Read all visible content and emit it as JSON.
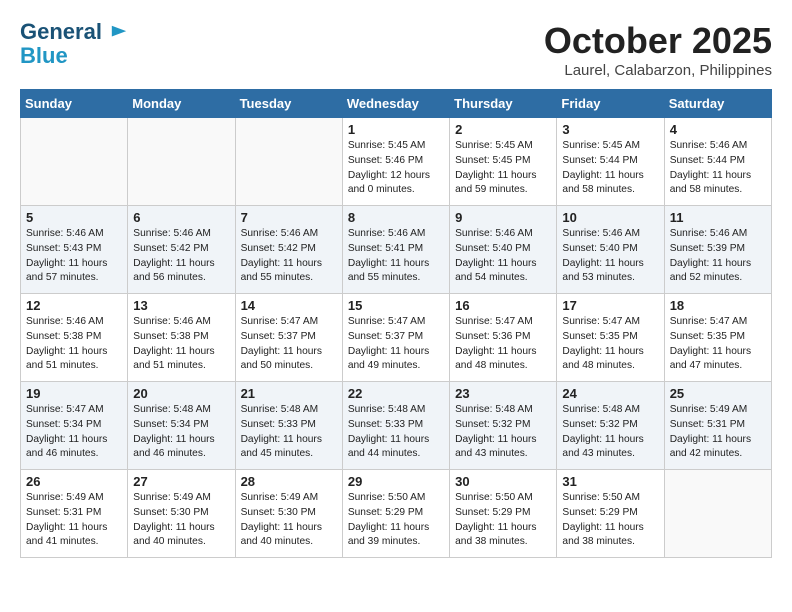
{
  "header": {
    "logo_line1": "General",
    "logo_line2": "Blue",
    "month": "October 2025",
    "location": "Laurel, Calabarzon, Philippines"
  },
  "days_of_week": [
    "Sunday",
    "Monday",
    "Tuesday",
    "Wednesday",
    "Thursday",
    "Friday",
    "Saturday"
  ],
  "weeks": [
    [
      {
        "day": "",
        "content": ""
      },
      {
        "day": "",
        "content": ""
      },
      {
        "day": "",
        "content": ""
      },
      {
        "day": "1",
        "content": "Sunrise: 5:45 AM\nSunset: 5:46 PM\nDaylight: 12 hours\nand 0 minutes."
      },
      {
        "day": "2",
        "content": "Sunrise: 5:45 AM\nSunset: 5:45 PM\nDaylight: 11 hours\nand 59 minutes."
      },
      {
        "day": "3",
        "content": "Sunrise: 5:45 AM\nSunset: 5:44 PM\nDaylight: 11 hours\nand 58 minutes."
      },
      {
        "day": "4",
        "content": "Sunrise: 5:46 AM\nSunset: 5:44 PM\nDaylight: 11 hours\nand 58 minutes."
      }
    ],
    [
      {
        "day": "5",
        "content": "Sunrise: 5:46 AM\nSunset: 5:43 PM\nDaylight: 11 hours\nand 57 minutes."
      },
      {
        "day": "6",
        "content": "Sunrise: 5:46 AM\nSunset: 5:42 PM\nDaylight: 11 hours\nand 56 minutes."
      },
      {
        "day": "7",
        "content": "Sunrise: 5:46 AM\nSunset: 5:42 PM\nDaylight: 11 hours\nand 55 minutes."
      },
      {
        "day": "8",
        "content": "Sunrise: 5:46 AM\nSunset: 5:41 PM\nDaylight: 11 hours\nand 55 minutes."
      },
      {
        "day": "9",
        "content": "Sunrise: 5:46 AM\nSunset: 5:40 PM\nDaylight: 11 hours\nand 54 minutes."
      },
      {
        "day": "10",
        "content": "Sunrise: 5:46 AM\nSunset: 5:40 PM\nDaylight: 11 hours\nand 53 minutes."
      },
      {
        "day": "11",
        "content": "Sunrise: 5:46 AM\nSunset: 5:39 PM\nDaylight: 11 hours\nand 52 minutes."
      }
    ],
    [
      {
        "day": "12",
        "content": "Sunrise: 5:46 AM\nSunset: 5:38 PM\nDaylight: 11 hours\nand 51 minutes."
      },
      {
        "day": "13",
        "content": "Sunrise: 5:46 AM\nSunset: 5:38 PM\nDaylight: 11 hours\nand 51 minutes."
      },
      {
        "day": "14",
        "content": "Sunrise: 5:47 AM\nSunset: 5:37 PM\nDaylight: 11 hours\nand 50 minutes."
      },
      {
        "day": "15",
        "content": "Sunrise: 5:47 AM\nSunset: 5:37 PM\nDaylight: 11 hours\nand 49 minutes."
      },
      {
        "day": "16",
        "content": "Sunrise: 5:47 AM\nSunset: 5:36 PM\nDaylight: 11 hours\nand 48 minutes."
      },
      {
        "day": "17",
        "content": "Sunrise: 5:47 AM\nSunset: 5:35 PM\nDaylight: 11 hours\nand 48 minutes."
      },
      {
        "day": "18",
        "content": "Sunrise: 5:47 AM\nSunset: 5:35 PM\nDaylight: 11 hours\nand 47 minutes."
      }
    ],
    [
      {
        "day": "19",
        "content": "Sunrise: 5:47 AM\nSunset: 5:34 PM\nDaylight: 11 hours\nand 46 minutes."
      },
      {
        "day": "20",
        "content": "Sunrise: 5:48 AM\nSunset: 5:34 PM\nDaylight: 11 hours\nand 46 minutes."
      },
      {
        "day": "21",
        "content": "Sunrise: 5:48 AM\nSunset: 5:33 PM\nDaylight: 11 hours\nand 45 minutes."
      },
      {
        "day": "22",
        "content": "Sunrise: 5:48 AM\nSunset: 5:33 PM\nDaylight: 11 hours\nand 44 minutes."
      },
      {
        "day": "23",
        "content": "Sunrise: 5:48 AM\nSunset: 5:32 PM\nDaylight: 11 hours\nand 43 minutes."
      },
      {
        "day": "24",
        "content": "Sunrise: 5:48 AM\nSunset: 5:32 PM\nDaylight: 11 hours\nand 43 minutes."
      },
      {
        "day": "25",
        "content": "Sunrise: 5:49 AM\nSunset: 5:31 PM\nDaylight: 11 hours\nand 42 minutes."
      }
    ],
    [
      {
        "day": "26",
        "content": "Sunrise: 5:49 AM\nSunset: 5:31 PM\nDaylight: 11 hours\nand 41 minutes."
      },
      {
        "day": "27",
        "content": "Sunrise: 5:49 AM\nSunset: 5:30 PM\nDaylight: 11 hours\nand 40 minutes."
      },
      {
        "day": "28",
        "content": "Sunrise: 5:49 AM\nSunset: 5:30 PM\nDaylight: 11 hours\nand 40 minutes."
      },
      {
        "day": "29",
        "content": "Sunrise: 5:50 AM\nSunset: 5:29 PM\nDaylight: 11 hours\nand 39 minutes."
      },
      {
        "day": "30",
        "content": "Sunrise: 5:50 AM\nSunset: 5:29 PM\nDaylight: 11 hours\nand 38 minutes."
      },
      {
        "day": "31",
        "content": "Sunrise: 5:50 AM\nSunset: 5:29 PM\nDaylight: 11 hours\nand 38 minutes."
      },
      {
        "day": "",
        "content": ""
      }
    ]
  ]
}
